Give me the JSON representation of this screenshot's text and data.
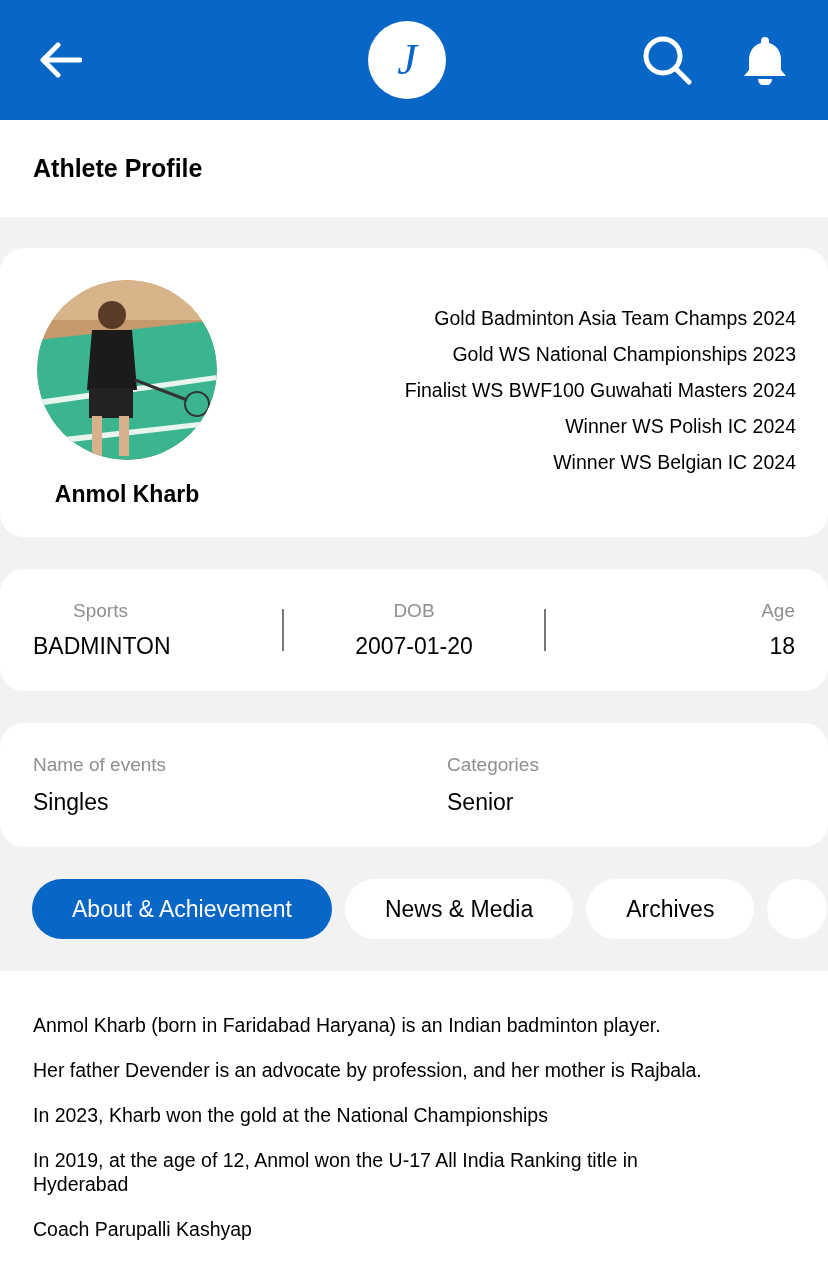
{
  "header": {
    "logo": "J"
  },
  "page_title": "Athlete Profile",
  "athlete": {
    "name": "Anmol Kharb",
    "achievements": [
      "Gold Badminton Asia Team Champs 2024",
      "Gold WS National Championships 2023",
      "Finalist WS BWF100 Guwahati Masters 2024",
      "Winner WS Polish IC 2024",
      "Winner WS Belgian IC 2024"
    ]
  },
  "stats": [
    {
      "label": "Sports",
      "value": "BADMINTON"
    },
    {
      "label": "DOB",
      "value": "2007-01-20"
    },
    {
      "label": "Age",
      "value": "18"
    }
  ],
  "details": [
    {
      "label": "Name of events",
      "value": "Singles"
    },
    {
      "label": "Categories",
      "value": "Senior"
    }
  ],
  "tabs": [
    {
      "label": "About & Achievement",
      "selected": true
    },
    {
      "label": "News & Media",
      "selected": false
    },
    {
      "label": "Archives",
      "selected": false
    }
  ],
  "about": [
    "Anmol Kharb (born in Faridabad Haryana) is an Indian badminton player.",
    "Her father Devender is an advocate by profession, and her mother is Rajbala.",
    "In 2023, Kharb won the gold at the National Championships",
    "In 2019, at the age of 12, Anmol won the U-17 All India Ranking title in Hyderabad",
    "Coach Parupalli Kashyap"
  ]
}
